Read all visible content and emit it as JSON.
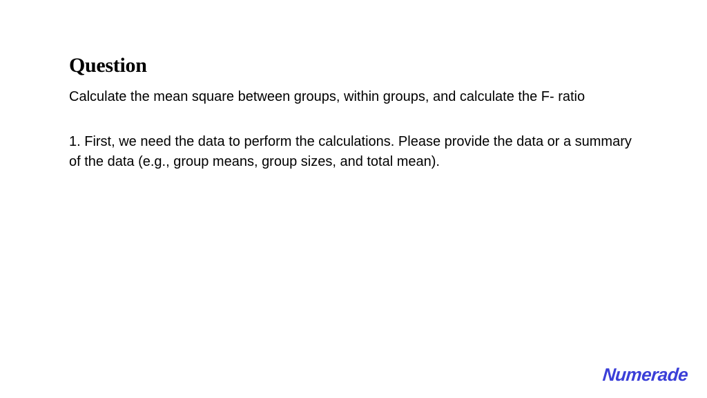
{
  "heading": "Question",
  "question_text": "Calculate the mean square between groups, within groups, and calculate the F- ratio",
  "answer_text": "1. First, we need the data to perform the calculations. Please provide the data or a summary of the data (e.g., group means, group sizes, and total mean).",
  "logo_text": "Numerade",
  "brand_color": "#3b3fd8"
}
